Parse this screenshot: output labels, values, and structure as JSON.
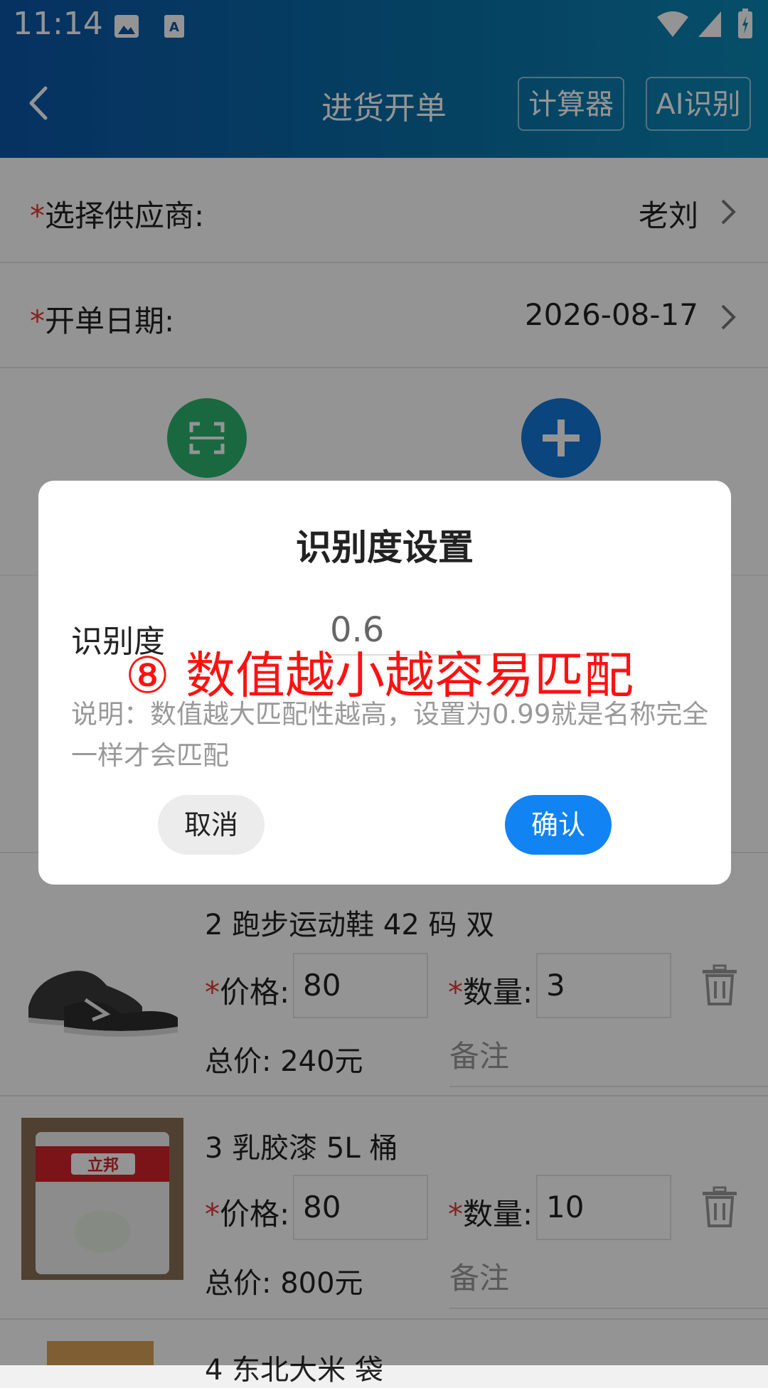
{
  "status_bar": {
    "time": "11:14"
  },
  "header": {
    "title": "进货开单",
    "calculator_label": "计算器",
    "ai_label": "AI识别"
  },
  "form": {
    "supplier": {
      "required_mark": "*",
      "label": "选择供应商:",
      "value": "老刘"
    },
    "date": {
      "required_mark": "*",
      "label": "开单日期:",
      "value": "2026-08-17"
    }
  },
  "items": [
    {
      "name": "2 跑步运动鞋 42 码 双",
      "required_mark": "*",
      "price_label": "价格:",
      "price": "80",
      "qty_label": "数量:",
      "qty": "3",
      "total": "总价: 240元",
      "remark_placeholder": "备注"
    },
    {
      "name": "3 乳胶漆 5L 桶",
      "required_mark": "*",
      "price_label": "价格:",
      "price": "80",
      "qty_label": "数量:",
      "qty": "10",
      "total": "总价: 800元",
      "remark_placeholder": "备注"
    },
    {
      "name": "4 东北大米 袋"
    }
  ],
  "dialog": {
    "title": "识别度设置",
    "field_label": "识别度",
    "field_value": "0.6",
    "description": "说明：数值越大匹配性越高，设置为0.99就是名称完全一样才会匹配",
    "cancel_label": "取消",
    "confirm_label": "确认"
  },
  "annotation": "⑧ 数值越小越容易匹配",
  "colors": {
    "header_start": "#0b56a8",
    "header_end": "#0b88b5",
    "primary_button": "#1183f2",
    "scan_button": "#2db36f",
    "add_button": "#1278d8",
    "required": "#e53935",
    "annotation": "#ff1111"
  }
}
